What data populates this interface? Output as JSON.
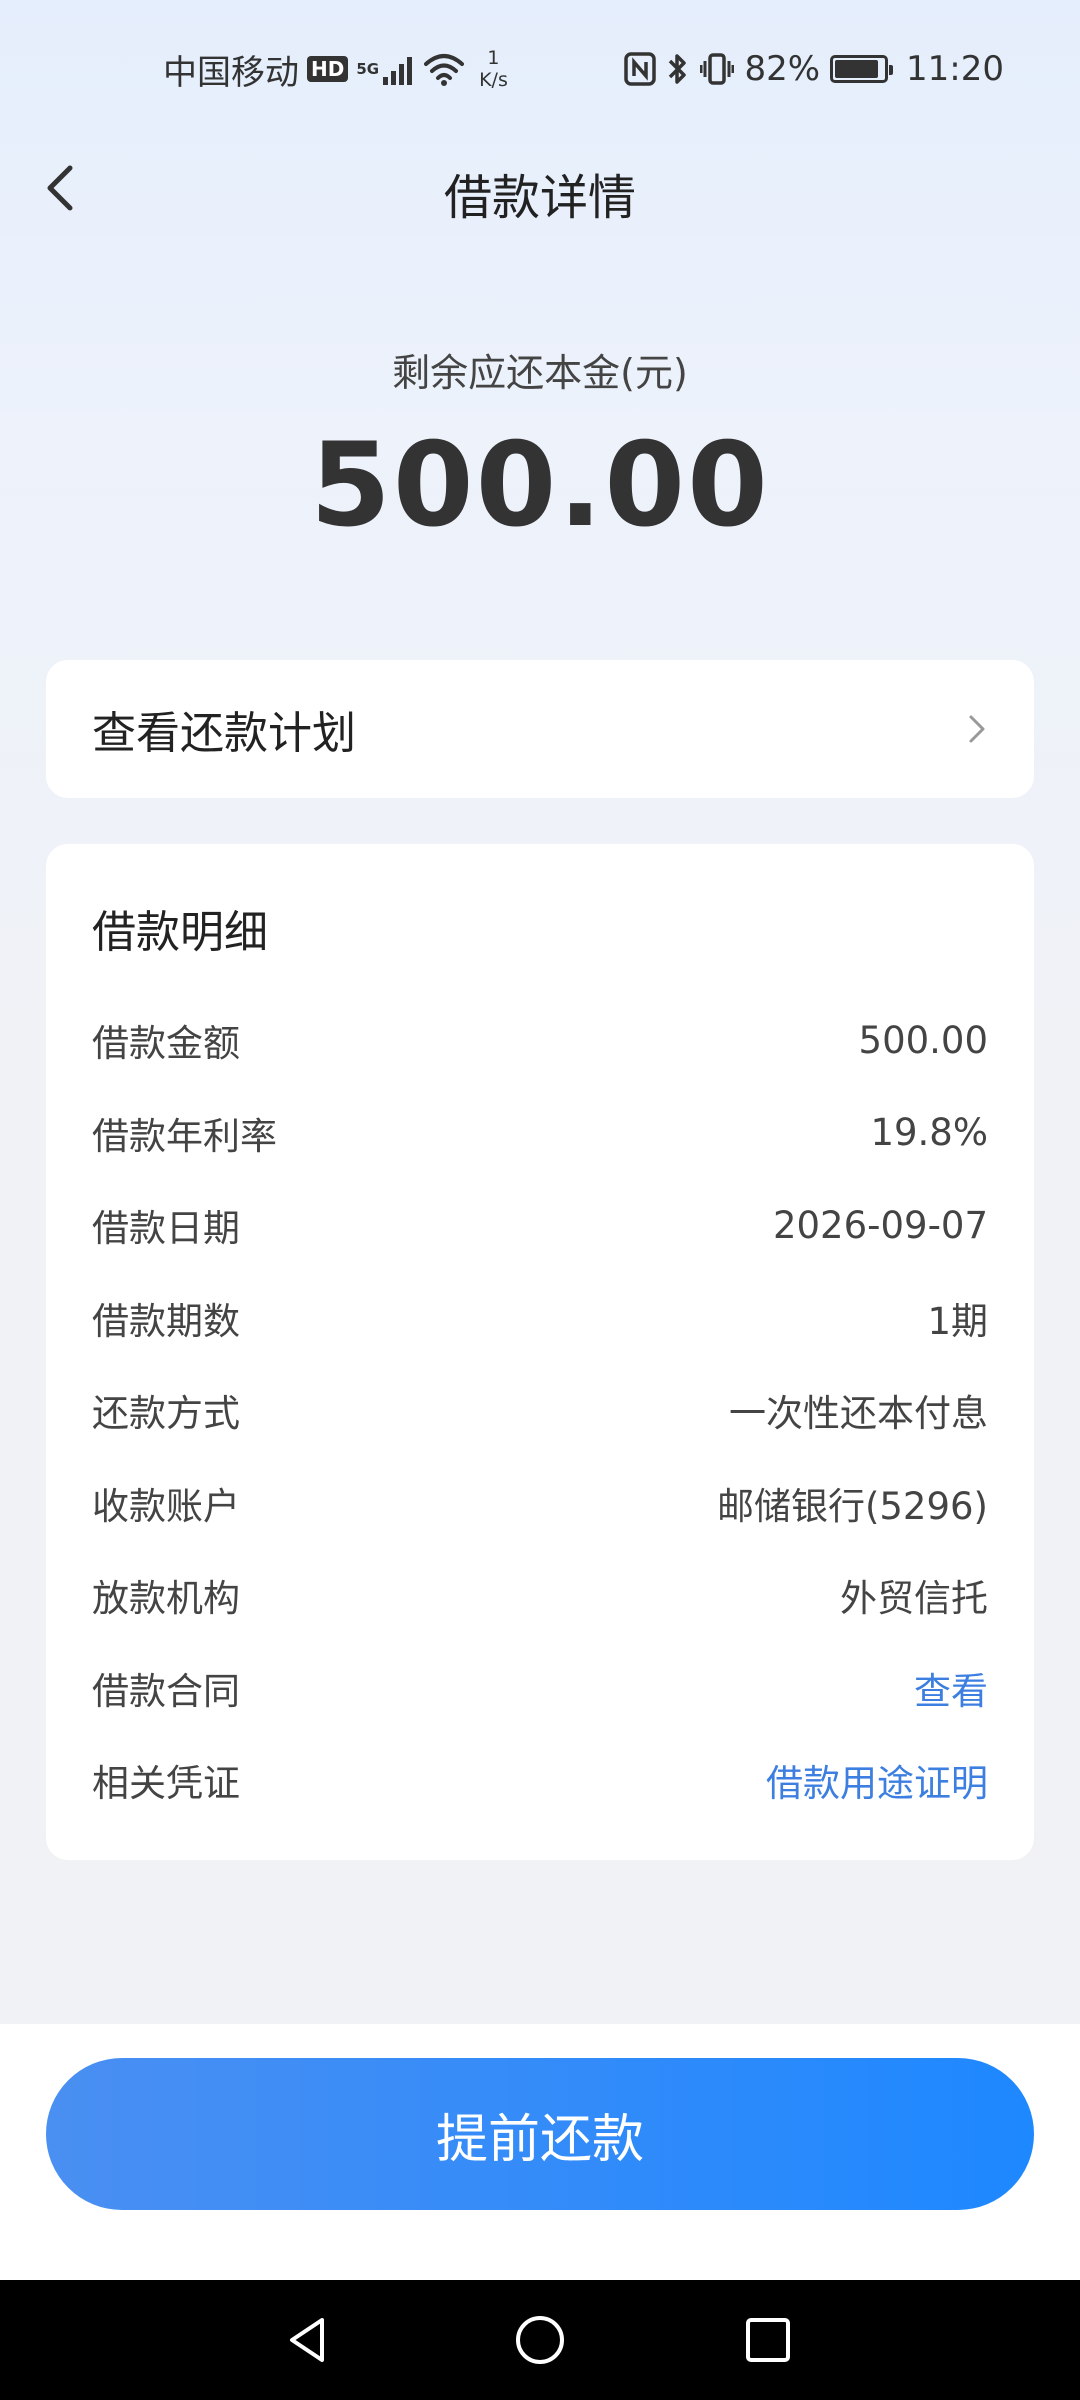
{
  "status_bar": {
    "carrier": "中国移动",
    "hd": "HD",
    "network": "5G",
    "speed_value": "1",
    "speed_unit": "K/s",
    "battery": "82%",
    "battery_level": 0.82,
    "time": "11:20"
  },
  "nav": {
    "title": "借款详情"
  },
  "balance": {
    "label": "剩余应还本金(元)",
    "amount": "500.00"
  },
  "plan": {
    "label": "查看还款计划"
  },
  "details": {
    "title": "借款明细",
    "rows": [
      {
        "label": "借款金额",
        "value": "500.00"
      },
      {
        "label": "借款年利率",
        "value": "19.8%"
      },
      {
        "label": "借款日期",
        "value": "2026-09-07"
      },
      {
        "label": "借款期数",
        "value": "1期"
      },
      {
        "label": "还款方式",
        "value": "一次性还本付息"
      },
      {
        "label": "收款账户",
        "value": "邮储银行(5296)"
      },
      {
        "label": "放款机构",
        "value": "外贸信托"
      },
      {
        "label": "借款合同",
        "value": "查看"
      },
      {
        "label": "相关凭证",
        "value": "借款用途证明"
      }
    ]
  },
  "actions": {
    "prepay_label": "提前还款"
  },
  "colors": {
    "accent": "#1e88ff",
    "link": "#3d7fe0"
  }
}
